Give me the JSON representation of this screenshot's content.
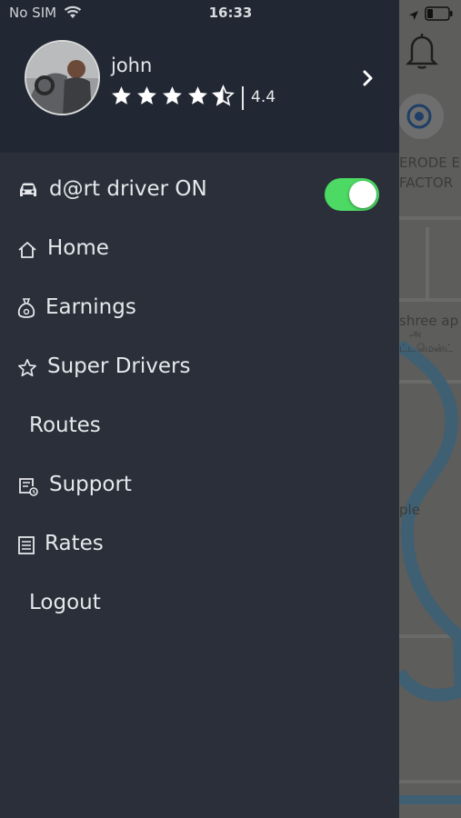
{
  "status_bar": {
    "carrier": "No SIM",
    "time": "16:33"
  },
  "profile": {
    "name": "john",
    "rating_value": "4.4",
    "rating": 4.4,
    "max_rating": 5
  },
  "menu": {
    "driver_status_label": "d@rt driver ON",
    "driver_status_on": true,
    "items": [
      {
        "label": "Home",
        "icon": "home-icon"
      },
      {
        "label": "Earnings",
        "icon": "money-bag-icon"
      },
      {
        "label": "Super Drivers",
        "icon": "star-icon"
      },
      {
        "label": "Routes",
        "icon": ""
      },
      {
        "label": "Support",
        "icon": "support-ticket-icon"
      },
      {
        "label": "Rates",
        "icon": "list-icon"
      },
      {
        "label": "Logout",
        "icon": ""
      }
    ]
  },
  "map": {
    "labels": [
      "ERODE E",
      "FACTOR",
      "shree ap",
      "அ",
      "ட்டமென்ட்",
      "ple"
    ]
  },
  "colors": {
    "drawer_bg": "#2a2f3a",
    "header_bg": "#222833",
    "toggle_on": "#4cd964",
    "text": "#e6e8eb"
  }
}
